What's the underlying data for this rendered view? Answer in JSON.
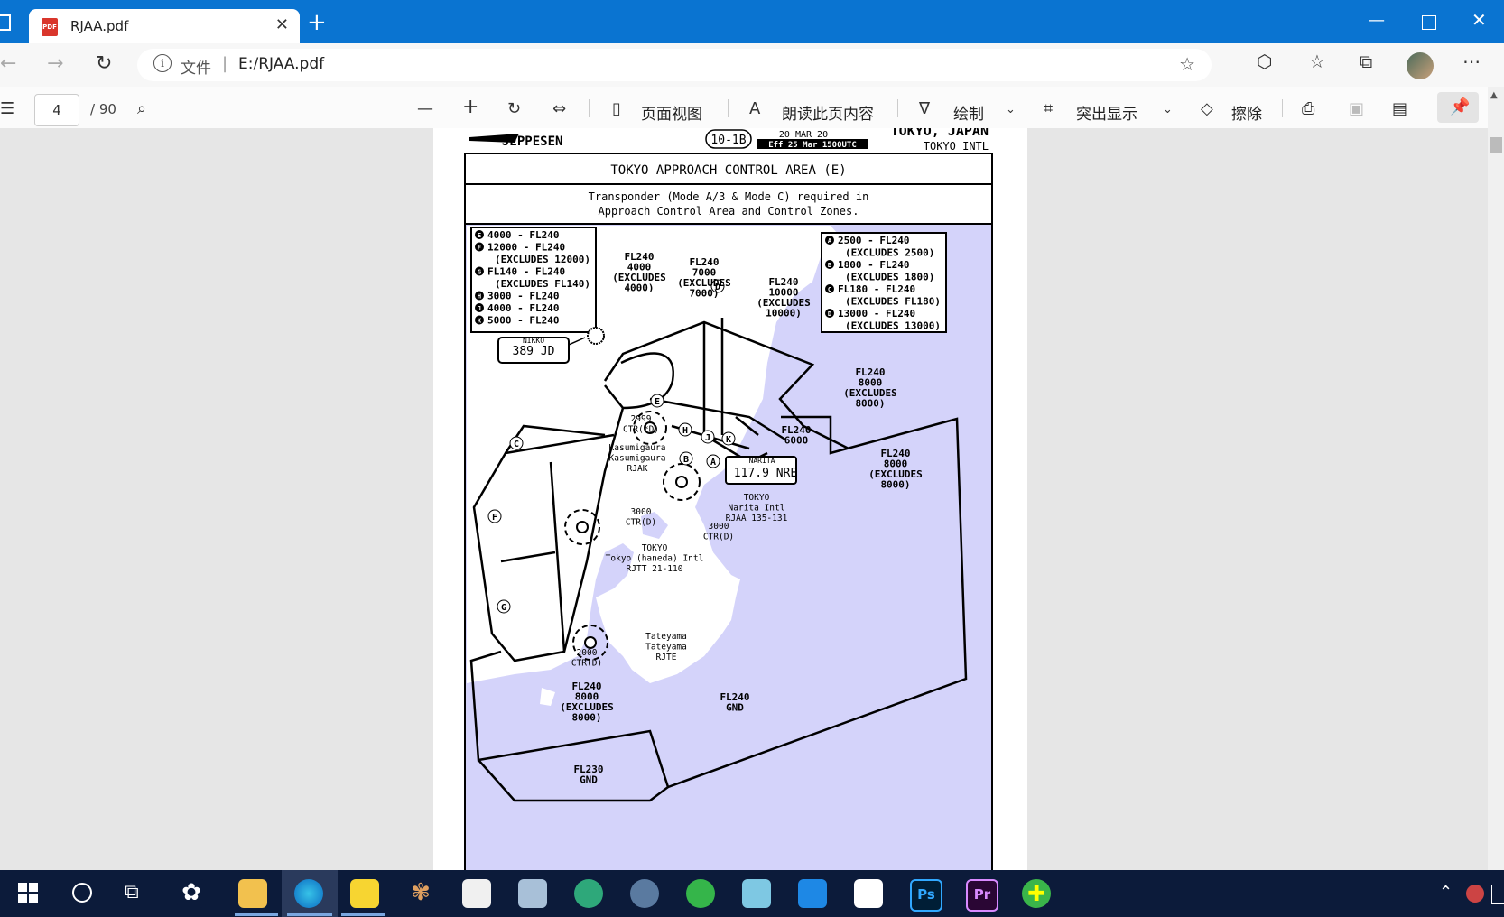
{
  "browser": {
    "tab_title": "RJAA.pdf",
    "tab_icon_text": "PDF",
    "address_scheme": "文件",
    "address_url": "E:/RJAA.pdf"
  },
  "pdf_toolbar": {
    "page_current": "4",
    "page_total": "/ 90",
    "page_view": "页面视图",
    "read_aloud": "朗读此页内容",
    "draw": "绘制",
    "highlight": "突出显示",
    "erase": "擦除"
  },
  "chart": {
    "brand": "JEPPESEN",
    "chart_number": "10-1B",
    "date": "20 MAR 20",
    "effective": "Eff 25 Mar 1500UTC",
    "location": "TOKYO, JAPAN",
    "airport": "TOKYO INTL",
    "title": "TOKYO APPROACH CONTROL AREA (E)",
    "note_line1": "Transponder (Mode A/3 & Mode C) required in",
    "note_line2": "Approach Control Area and Control Zones.",
    "legend_left": [
      {
        "key": "E",
        "text": "4000 - FL240"
      },
      {
        "key": "F",
        "text": "12000 - FL240"
      },
      {
        "key": "",
        "text": "(EXCLUDES 12000)"
      },
      {
        "key": "G",
        "text": "FL140 - FL240"
      },
      {
        "key": "",
        "text": "(EXCLUDES FL140)"
      },
      {
        "key": "H",
        "text": "3000 - FL240"
      },
      {
        "key": "J",
        "text": "4000 - FL240"
      },
      {
        "key": "K",
        "text": "5000 - FL240"
      }
    ],
    "legend_right": [
      {
        "key": "A",
        "text": "2500 - FL240"
      },
      {
        "key": "",
        "text": "(EXCLUDES 2500)"
      },
      {
        "key": "B",
        "text": "1800 - FL240"
      },
      {
        "key": "",
        "text": "(EXCLUDES 1800)"
      },
      {
        "key": "C",
        "text": "FL180 - FL240"
      },
      {
        "key": "",
        "text": "(EXCLUDES FL180)"
      },
      {
        "key": "D",
        "text": "13000 - FL240"
      },
      {
        "key": "",
        "text": "(EXCLUDES 13000)"
      }
    ],
    "nikko_label": "NIKKO",
    "nikko_freq": "389 JD",
    "narita_label": "NARITA",
    "narita_freq": "117.9 NRE",
    "narita_dh": "D\n(H)",
    "fl_4000": [
      "FL240",
      "4000",
      "(EXCLUDES",
      "4000)"
    ],
    "fl_7000": [
      "FL240",
      "7000",
      "(EXCLUDES",
      "7000)"
    ],
    "fl_10000": [
      "FL240",
      "10000",
      "(EXCLUDES",
      "10000)"
    ],
    "fl_8000_ne": [
      "FL240",
      "8000",
      "(EXCLUDES",
      "8000)"
    ],
    "fl_6000": [
      "FL240",
      "6000"
    ],
    "fl_8000_e": [
      "FL240",
      "8000",
      "(EXCLUDES",
      "8000)"
    ],
    "fl_8000_sw": [
      "FL240",
      "8000",
      "(EXCLUDES",
      "8000)"
    ],
    "fl_gnd": [
      "FL240",
      "GND"
    ],
    "fl230_gnd": [
      "FL230",
      "GND"
    ],
    "kasumigaura_ctr": [
      "2999",
      "CTR(*D)"
    ],
    "kasumigaura": [
      "Kasumigaura",
      "Kasumigaura",
      "RJAK"
    ],
    "narita_ctr": [
      "3000",
      "CTR(D)"
    ],
    "narita_airport": [
      "TOKYO",
      "Narita Intl",
      "RJAA 135-131"
    ],
    "haneda_ctr": [
      "3000",
      "CTR(D)"
    ],
    "haneda_airport": [
      "TOKYO",
      "Tokyo (haneda) Intl",
      "RJTT 21-110"
    ],
    "tateyama_ctr": [
      "2000",
      "CTR(D)"
    ],
    "tateyama": [
      "Tateyama",
      "Tateyama",
      "RJTE"
    ],
    "area_labels": {
      "c": "C",
      "f": "F",
      "g": "G",
      "e": "E",
      "h": "H",
      "j": "J",
      "k": "K",
      "a": "A",
      "b": "B",
      "d": "D"
    }
  },
  "colors": {
    "titlebar": "#0a74d1",
    "water": "#d4d3fa",
    "taskbar": "#0c1b3a"
  }
}
